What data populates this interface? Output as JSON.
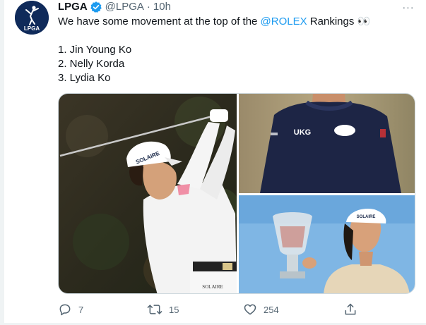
{
  "tweet": {
    "display_name": "LPGA",
    "handle": "@LPGA",
    "separator": "·",
    "time": "10h",
    "avatar_text": "LPGA",
    "text_before_mention": "We have some movement at the top of the ",
    "mention": "@ROLEX",
    "text_after_mention": " Rankings 👀",
    "list": [
      "1. Jin Young Ko",
      "2. Nelly Korda",
      "3. Lydia Ko"
    ],
    "more_label": "···"
  },
  "media": {
    "photo1": {
      "cap_brand": "SOLAIRE",
      "belt_brand": "SOLAIRE"
    },
    "photo2": {
      "chest_brand": "UKG"
    },
    "photo3": {
      "cap_brand": "SOLAIRE"
    }
  },
  "actions": {
    "reply_count": "7",
    "retweet_count": "15",
    "like_count": "254"
  },
  "colors": {
    "accent": "#1d9bf0",
    "text": "#0f1419",
    "secondary": "#536471"
  }
}
